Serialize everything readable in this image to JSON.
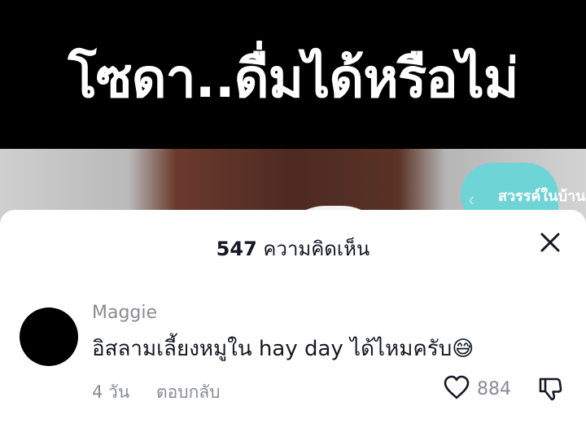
{
  "video": {
    "caption": "โซดา..ดื่มได้หรือไม่",
    "watermark": "สวรรค์ในบ้าน"
  },
  "comments_sheet": {
    "count": "547",
    "count_label": "ความคิดเห็น",
    "close_icon": "close-icon"
  },
  "comment": {
    "username": "Maggie",
    "text": "อิสลามเลี้ยงหมูใน hay day ได้ไหมครับ",
    "emoji": "😅",
    "time": "4 วัน",
    "reply_label": "ตอบกลับ",
    "like_count": "884",
    "like_icon": "heart-outline-icon",
    "dislike_icon": "thumbs-down-icon"
  },
  "colors": {
    "text_primary": "#161823",
    "text_secondary": "#8a8b91",
    "watermark_bg": "#6fd4d6"
  }
}
